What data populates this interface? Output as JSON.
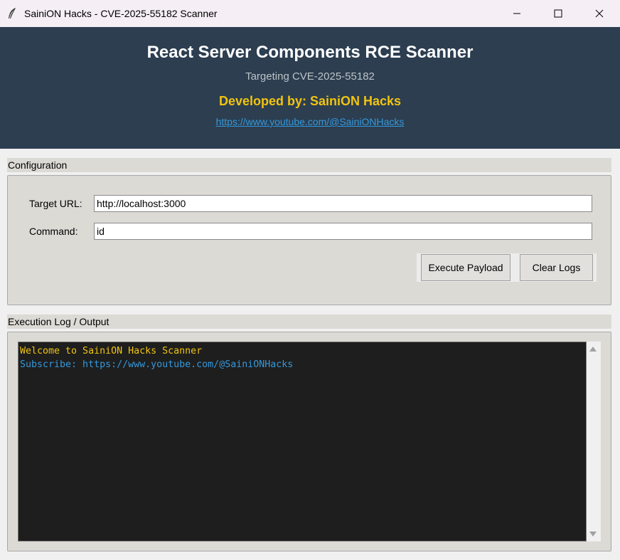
{
  "window": {
    "title": "SainiON Hacks - CVE-2025-55182 Scanner",
    "icon": "feather-icon"
  },
  "header": {
    "title": "React Server Components RCE Scanner",
    "subtitle": "Targeting CVE-2025-55182",
    "developer": "Developed by: SainiON Hacks",
    "link": "https://www.youtube.com/@SainiONHacks",
    "bg_color": "#2c3e50",
    "dev_color": "#f1c40f",
    "link_color": "#3498db"
  },
  "config": {
    "section_label": "Configuration",
    "target_url_label": "Target URL:",
    "target_url_value": "http://localhost:3000",
    "command_label": "Command:",
    "command_value": "id",
    "execute_button": "Execute Payload",
    "clear_button": "Clear Logs"
  },
  "log": {
    "section_label": "Execution Log / Output",
    "lines": [
      {
        "text": "Welcome to SainiON Hacks Scanner",
        "color": "#f1c40f"
      },
      {
        "text": "Subscribe: https://www.youtube.com/@SainiONHacks",
        "color": "#3498db"
      }
    ]
  }
}
